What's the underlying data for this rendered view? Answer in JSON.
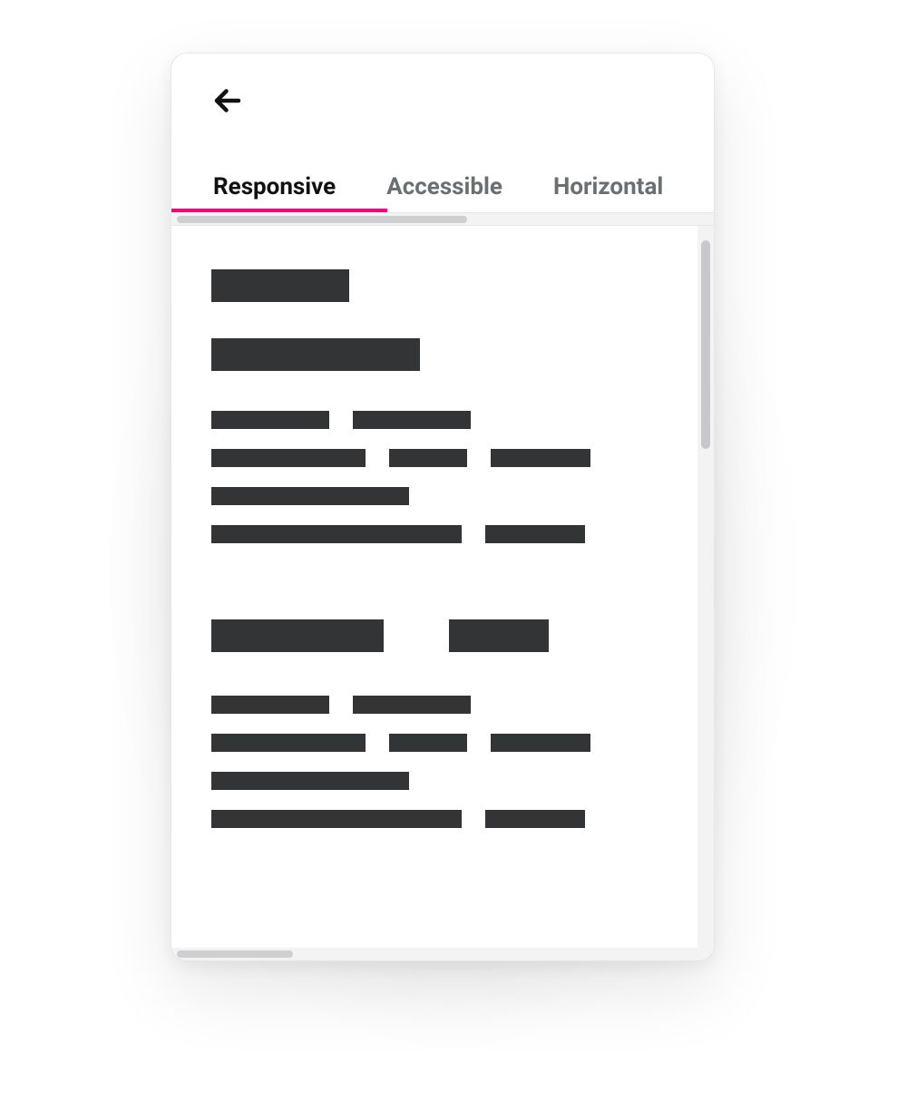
{
  "tabs": {
    "items": [
      {
        "label": "Responsive"
      },
      {
        "label": "Accessible"
      },
      {
        "label": "Horizontal"
      }
    ],
    "active_index": 0
  },
  "colors": {
    "accent": "#ff007a",
    "text_primary": "#111111",
    "text_muted": "#6b6e72",
    "skeleton": "#333436",
    "scrollbar_track": "#f3f3f4",
    "scrollbar_thumb": "#cfcfd2",
    "border": "#e7e7e9"
  }
}
